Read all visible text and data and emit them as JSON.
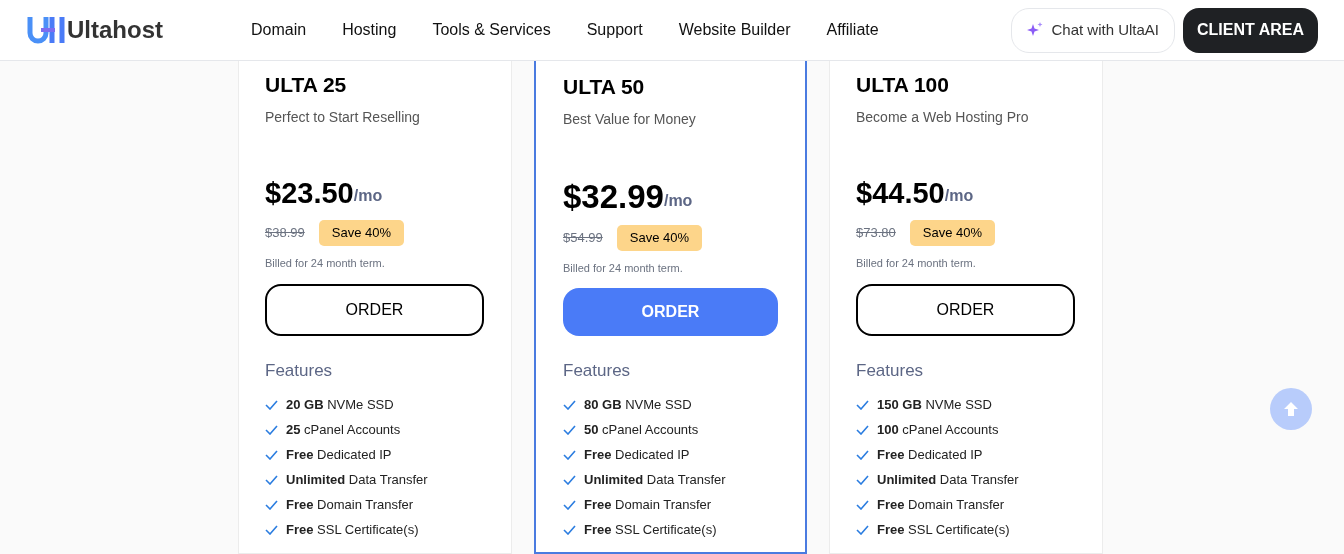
{
  "header": {
    "brand": "Ultahost",
    "nav": [
      "Domain",
      "Hosting",
      "Tools & Services",
      "Support",
      "Website Builder",
      "Affiliate"
    ],
    "chat_button": "Chat with UltaAI",
    "client_button": "CLIENT AREA"
  },
  "plans": [
    {
      "name": "ULTA 25",
      "tagline": "Perfect to Start Reselling",
      "price": "$23.50",
      "period": "/mo",
      "old_price": "$38.99",
      "badge": "Save 40%",
      "billing": "Billed for 24 month term.",
      "order": "ORDER",
      "featured": false,
      "features_title": "Features",
      "features": [
        "**20 GB** NVMe SSD",
        "**25** cPanel Accounts",
        "**Free** Dedicated IP",
        "**Unlimited** Data Transfer",
        "**Free** Domain Transfer",
        "**Free** SSL Certificate(s)"
      ]
    },
    {
      "name": "ULTA 50",
      "tagline": "Best Value for Money",
      "price": "$32.99",
      "period": "/mo",
      "old_price": "$54.99",
      "badge": "Save 40%",
      "billing": "Billed for 24 month term.",
      "order": "ORDER",
      "featured": true,
      "features_title": "Features",
      "features": [
        "**80 GB** NVMe SSD",
        "**50** cPanel Accounts",
        "**Free** Dedicated IP",
        "**Unlimited** Data Transfer",
        "**Free** Domain Transfer",
        "**Free** SSL Certificate(s)"
      ]
    },
    {
      "name": "ULTA 100",
      "tagline": "Become a Web Hosting Pro",
      "price": "$44.50",
      "period": "/mo",
      "old_price": "$73.80",
      "badge": "Save 40%",
      "billing": "Billed for 24 month term.",
      "order": "ORDER",
      "featured": false,
      "features_title": "Features",
      "features": [
        "**150 GB** NVMe SSD",
        "**100** cPanel Accounts",
        "**Free** Dedicated IP",
        "**Unlimited** Data Transfer",
        "**Free** Domain Transfer",
        "**Free** SSL Certificate(s)"
      ]
    }
  ]
}
